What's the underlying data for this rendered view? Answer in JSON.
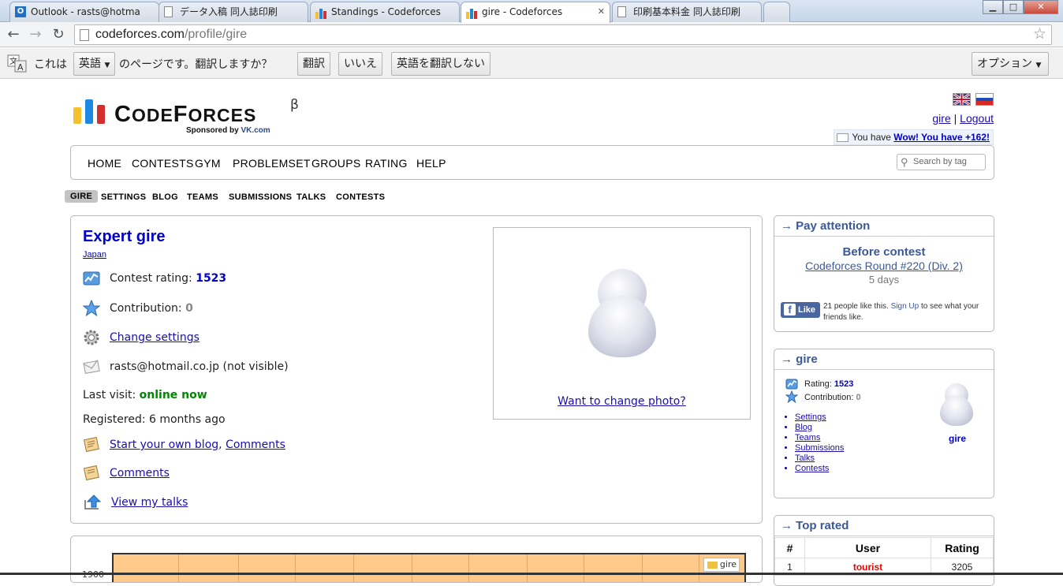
{
  "browser": {
    "tabs": [
      {
        "label": "Outlook - rasts@hotma",
        "icon": "outlook-icon"
      },
      {
        "label": "データ入稿 同人誌印刷",
        "icon": "page-icon"
      },
      {
        "label": "Standings - Codeforces",
        "icon": "codeforces-icon"
      },
      {
        "label": "gire - Codeforces",
        "icon": "codeforces-icon"
      },
      {
        "label": "印刷基本料金 同人誌印刷",
        "icon": "page-icon"
      }
    ],
    "url_host": "codeforces.com",
    "url_path": "/profile/gire",
    "window_buttons": {
      "minimize": "▁",
      "maximize": "□",
      "close": "✕"
    }
  },
  "translate_bar": {
    "prefix": "これは",
    "language": "英語",
    "suffix": "のページです。翻訳しますか？",
    "translate_button": "翻訳",
    "no_button": "いいえ",
    "never_button": "英語を翻訳しない",
    "options_button": "オプション"
  },
  "header": {
    "logo_text_big_c": "C",
    "logo_text_ode": "ODE",
    "logo_text_big_f": "F",
    "logo_text_orces": "ORCES",
    "logo_beta": "β",
    "sponsor_prefix": "Sponsored by ",
    "sponsor_name": "VK.com",
    "user_link": "gire",
    "separator": "|",
    "logout_link": "Logout",
    "you_have_prefix": "You have ",
    "you_have_link": "Wow! You have +162!"
  },
  "main_menu": {
    "items": [
      "HOME",
      "CONTESTS",
      "GYM",
      "PROBLEMSET",
      "GROUPS",
      "RATING",
      "HELP"
    ],
    "search_placeholder": "Search by tag"
  },
  "second_menu": {
    "items": [
      "GIRE",
      "SETTINGS",
      "BLOG",
      "TEAMS",
      "SUBMISSIONS",
      "TALKS",
      "CONTESTS"
    ]
  },
  "profile": {
    "title": "Expert gire",
    "country": "Japan",
    "rating_label": "Contest rating: ",
    "rating_value": "1523",
    "contribution_label": "Contribution: ",
    "contribution_value": "0",
    "change_settings": "Change settings",
    "email": "rasts@hotmail.co.jp (not visible)",
    "last_visit_label": "Last visit: ",
    "last_visit_value": "online now",
    "registered": "Registered: 6 months ago",
    "blog_link": "Start your own blog",
    "blog_sep": ", ",
    "comments_link": "Comments",
    "comments_link2": "Comments",
    "talks_link": "View my talks",
    "photo_link": "Want to change photo?"
  },
  "graph": {
    "ytick": "1900",
    "legend": "gire",
    "legend_color": "#edc240"
  },
  "pay_attention": {
    "title": "→ Pay attention",
    "before": "Before contest",
    "contest_link": "Codeforces Round #220 (Div. 2)",
    "days": "5 days",
    "like": "Like",
    "fb_f": "f",
    "fb_text_a": "21 people like this. ",
    "fb_signup": "Sign Up",
    "fb_text_b": " to see what your friends like."
  },
  "user_box": {
    "title": "→ gire",
    "rating_label": "Rating: ",
    "rating_value": "1523",
    "contribution_label": "Contribution: ",
    "contribution_value": "0",
    "links": [
      "Settings",
      "Blog",
      "Teams",
      "Submissions",
      "Talks",
      "Contests"
    ],
    "avatar_name": "gire"
  },
  "top_rated": {
    "title": "→ Top rated",
    "headers": [
      "#",
      "User",
      "Rating"
    ],
    "rows": [
      {
        "rank": "1",
        "user": "tourist",
        "rating": "3205"
      }
    ]
  }
}
